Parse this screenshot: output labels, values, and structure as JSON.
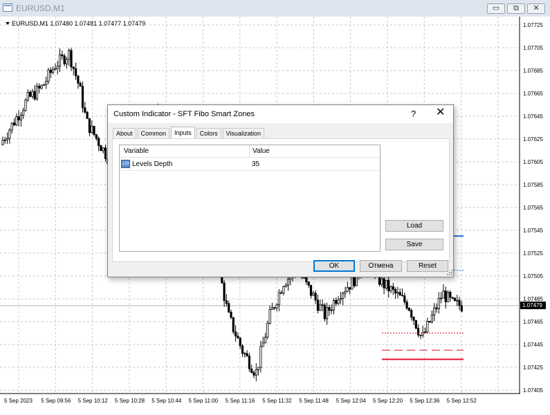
{
  "window": {
    "title": "EURUSD,M1",
    "minimize": "▭",
    "restore": "⧉",
    "close": "✕"
  },
  "chart": {
    "symbol_info": "EURUSD,M1  1.07480 1.07481 1.07477 1.07479",
    "price_labels": [
      "1.07725",
      "1.07705",
      "1.07685",
      "1.07665",
      "1.07645",
      "1.07625",
      "1.07605",
      "1.07585",
      "1.07565",
      "1.07545",
      "1.07525",
      "1.07505",
      "1.07485",
      "1.07465",
      "1.07445",
      "1.07425",
      "1.07405"
    ],
    "current_price": "1.07479",
    "time_labels": [
      "5 Sep 2023",
      "5 Sep 09:56",
      "5 Sep 10:12",
      "5 Sep 10:28",
      "5 Sep 10:44",
      "5 Sep 11:00",
      "5 Sep 11:16",
      "5 Sep 11:32",
      "5 Sep 11:48",
      "5 Sep 12:04",
      "5 Sep 12:20",
      "5 Sep 12:36",
      "5 Sep 12:52"
    ],
    "colors": {
      "bull_bear": "#000000",
      "grid": "#c0c0c0",
      "level_blue": "#1e6fd9",
      "level_red": "#e0102a"
    },
    "levels": [
      {
        "price": 1.0754,
        "color": "#1e6fd9",
        "style": "solid"
      },
      {
        "price": 1.0751,
        "color": "#1e6fd9",
        "style": "dotted"
      },
      {
        "price": 1.07455,
        "color": "#e0102a",
        "style": "dotted"
      },
      {
        "price": 1.0744,
        "color": "#e0102a",
        "style": "dashed"
      },
      {
        "price": 1.07432,
        "color": "#e0102a",
        "style": "solid"
      }
    ]
  },
  "dialog": {
    "title": "Custom Indicator - SFT Fibo Smart Zones",
    "help": "?",
    "close": "✕",
    "tabs": [
      {
        "label": "About",
        "active": false
      },
      {
        "label": "Common",
        "active": false
      },
      {
        "label": "Inputs",
        "active": true
      },
      {
        "label": "Colors",
        "active": false
      },
      {
        "label": "Visualization",
        "active": false
      }
    ],
    "table": {
      "columns": [
        "Variable",
        "Value"
      ],
      "rows": [
        {
          "icon": "123",
          "variable": "Levels Depth",
          "value": "35"
        }
      ]
    },
    "buttons": {
      "load": "Load",
      "save": "Save",
      "ok": "OK",
      "cancel": "Отмена",
      "reset": "Reset"
    }
  }
}
